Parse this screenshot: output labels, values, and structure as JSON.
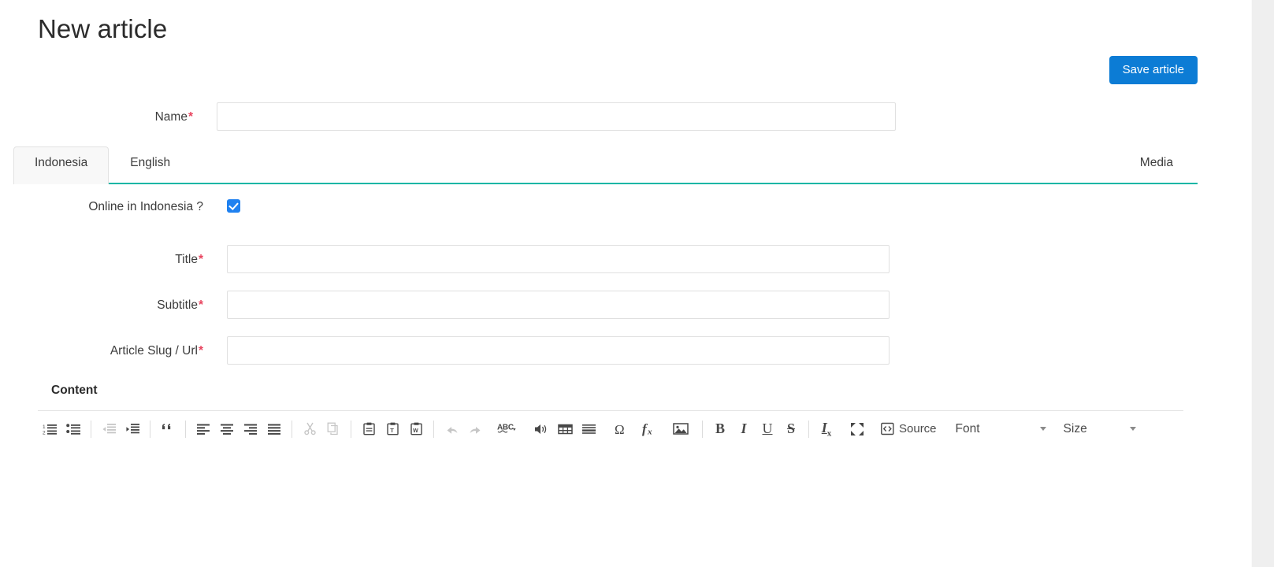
{
  "page": {
    "title": "New article"
  },
  "toolbar": {
    "save_label": "Save article"
  },
  "form": {
    "name": {
      "label": "Name",
      "required_marker": "*",
      "value": "",
      "placeholder": ""
    }
  },
  "tabs": {
    "items": [
      {
        "label": "Indonesia",
        "active": true
      },
      {
        "label": "English",
        "active": false
      }
    ],
    "right": {
      "label": "Media",
      "active": false
    },
    "underline_color": "#0fb6a5"
  },
  "panel": {
    "online": {
      "label": "Online in Indonesia ?",
      "checked": true,
      "checkbox_color": "#1f81f0"
    },
    "title": {
      "label": "Title",
      "required_marker": "*",
      "value": "",
      "placeholder": ""
    },
    "subtitle": {
      "label": "Subtitle",
      "required_marker": "*",
      "value": "",
      "placeholder": ""
    },
    "slug": {
      "label": "Article Slug / Url",
      "required_marker": "*",
      "value": "",
      "placeholder": ""
    },
    "content": {
      "heading": "Content",
      "body_value": ""
    }
  },
  "editor_toolbar": {
    "buttons": [
      {
        "name": "numbered-list-icon",
        "title": "Insert/Remove Numbered List",
        "disabled": false
      },
      {
        "name": "bulleted-list-icon",
        "title": "Insert/Remove Bulleted List",
        "disabled": false
      },
      {
        "name": "decrease-indent-icon",
        "title": "Decrease Indent",
        "disabled": true
      },
      {
        "name": "increase-indent-icon",
        "title": "Increase Indent",
        "disabled": false
      },
      {
        "name": "blockquote-icon",
        "title": "Block Quote",
        "disabled": false
      },
      {
        "name": "align-left-icon",
        "title": "Align Left",
        "disabled": false
      },
      {
        "name": "align-center-icon",
        "title": "Center",
        "disabled": false
      },
      {
        "name": "align-right-icon",
        "title": "Align Right",
        "disabled": false
      },
      {
        "name": "justify-icon",
        "title": "Justify",
        "disabled": false
      },
      {
        "name": "cut-icon",
        "title": "Cut",
        "disabled": true
      },
      {
        "name": "copy-icon",
        "title": "Copy",
        "disabled": true
      },
      {
        "name": "paste-icon",
        "title": "Paste",
        "disabled": false
      },
      {
        "name": "paste-as-text-icon",
        "title": "Paste as plain text",
        "disabled": false
      },
      {
        "name": "paste-from-word-icon",
        "title": "Paste from Word",
        "disabled": false
      },
      {
        "name": "undo-icon",
        "title": "Undo",
        "disabled": true
      },
      {
        "name": "redo-icon",
        "title": "Redo",
        "disabled": true
      },
      {
        "name": "spellcheck-icon",
        "title": "Spell Check As You Type",
        "disabled": false
      },
      {
        "name": "audio-icon",
        "title": "Audio",
        "disabled": false
      },
      {
        "name": "table-icon",
        "title": "Table",
        "disabled": false
      },
      {
        "name": "horizontal-rule-icon",
        "title": "Insert Horizontal Line",
        "disabled": false
      },
      {
        "name": "special-character-icon",
        "title": "Insert Special Character",
        "disabled": false
      },
      {
        "name": "math-formula-icon",
        "title": "Mathematical Formula",
        "disabled": false
      },
      {
        "name": "image-icon",
        "title": "Image",
        "disabled": false
      },
      {
        "name": "bold-icon",
        "title": "Bold",
        "disabled": false
      },
      {
        "name": "italic-icon",
        "title": "Italic",
        "disabled": false
      },
      {
        "name": "underline-icon",
        "title": "Underline",
        "disabled": false
      },
      {
        "name": "strikethrough-icon",
        "title": "Strikethrough",
        "disabled": false
      },
      {
        "name": "remove-format-icon",
        "title": "Remove Format",
        "disabled": false
      },
      {
        "name": "maximize-icon",
        "title": "Maximize",
        "disabled": false
      }
    ],
    "source_label": "Source",
    "font_label": "Font",
    "size_label": "Size"
  }
}
